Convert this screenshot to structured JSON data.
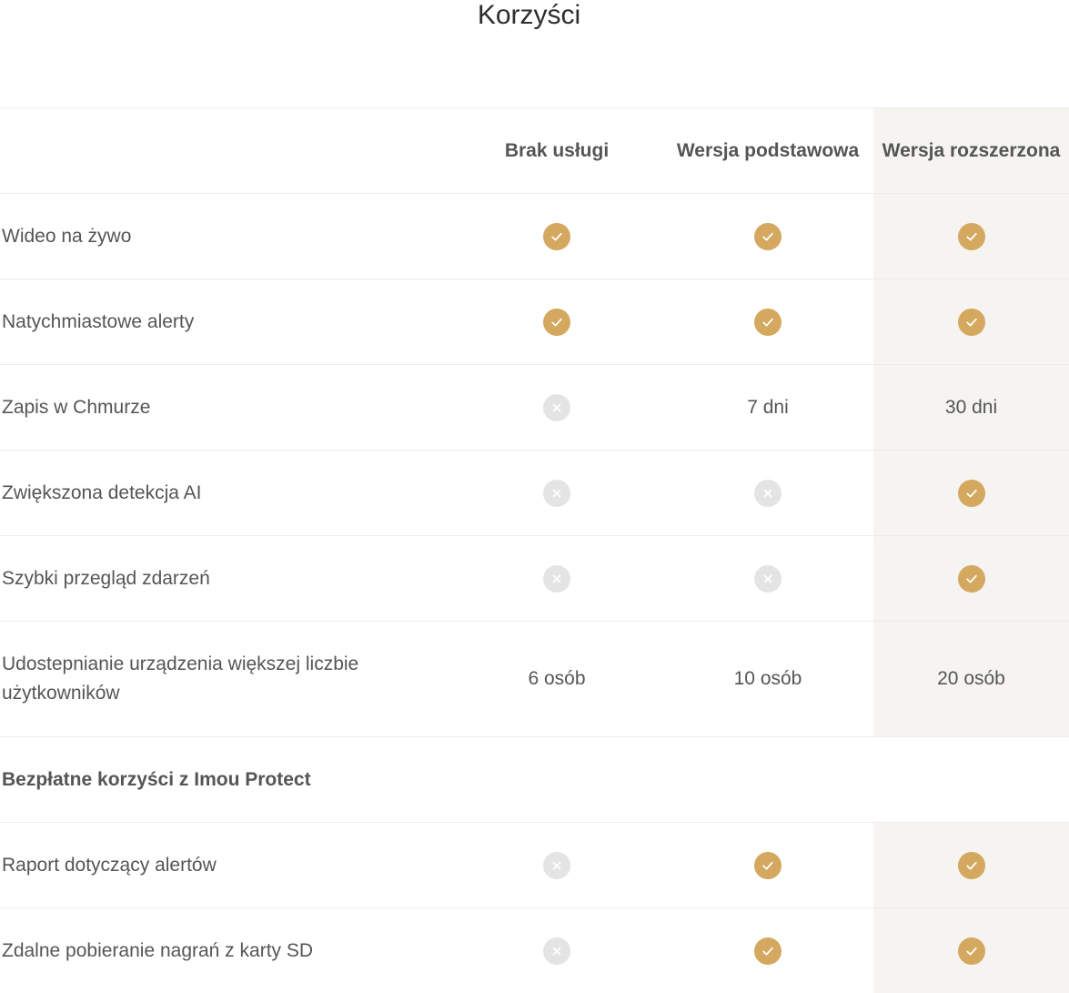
{
  "page": {
    "title": "Korzyści"
  },
  "colors": {
    "check": "#d4a85e",
    "cross": "#e4e4e4",
    "highlight_column": "#f5f4f1",
    "text": "#555555"
  },
  "table": {
    "columns": [
      "Brak usługi",
      "Wersja podstawowa",
      "Wersja rozszerzona"
    ],
    "highlight_column_index": 2,
    "rows": [
      {
        "label": "Wideo na żywo",
        "values": [
          {
            "type": "icon",
            "icon": "check-icon"
          },
          {
            "type": "icon",
            "icon": "check-icon"
          },
          {
            "type": "icon",
            "icon": "check-icon"
          }
        ]
      },
      {
        "label": "Natychmiastowe alerty",
        "values": [
          {
            "type": "icon",
            "icon": "check-icon"
          },
          {
            "type": "icon",
            "icon": "check-icon"
          },
          {
            "type": "icon",
            "icon": "check-icon"
          }
        ]
      },
      {
        "label": "Zapis w Chmurze",
        "values": [
          {
            "type": "icon",
            "icon": "cross-icon"
          },
          {
            "type": "text",
            "text": "7 dni"
          },
          {
            "type": "text",
            "text": "30 dni"
          }
        ]
      },
      {
        "label": "Zwiększona detekcja AI",
        "values": [
          {
            "type": "icon",
            "icon": "cross-icon"
          },
          {
            "type": "icon",
            "icon": "cross-icon"
          },
          {
            "type": "icon",
            "icon": "check-icon"
          }
        ]
      },
      {
        "label": "Szybki przegląd zdarzeń",
        "values": [
          {
            "type": "icon",
            "icon": "cross-icon"
          },
          {
            "type": "icon",
            "icon": "cross-icon"
          },
          {
            "type": "icon",
            "icon": "check-icon"
          }
        ]
      },
      {
        "label": "Udostepnianie urządzenia większej liczbie użytkowników",
        "tall": true,
        "values": [
          {
            "type": "text",
            "text": "6 osób"
          },
          {
            "type": "text",
            "text": "10 osób"
          },
          {
            "type": "text",
            "text": "20 osób"
          }
        ]
      }
    ],
    "section": {
      "title": "Bezpłatne korzyści z Imou Protect",
      "rows": [
        {
          "label": "Raport dotyczący alertów",
          "values": [
            {
              "type": "icon",
              "icon": "cross-icon"
            },
            {
              "type": "icon",
              "icon": "check-icon"
            },
            {
              "type": "icon",
              "icon": "check-icon"
            }
          ]
        },
        {
          "label": "Zdalne pobieranie nagrań z karty SD",
          "values": [
            {
              "type": "icon",
              "icon": "cross-icon"
            },
            {
              "type": "icon",
              "icon": "check-icon"
            },
            {
              "type": "icon",
              "icon": "check-icon"
            }
          ]
        }
      ]
    }
  }
}
